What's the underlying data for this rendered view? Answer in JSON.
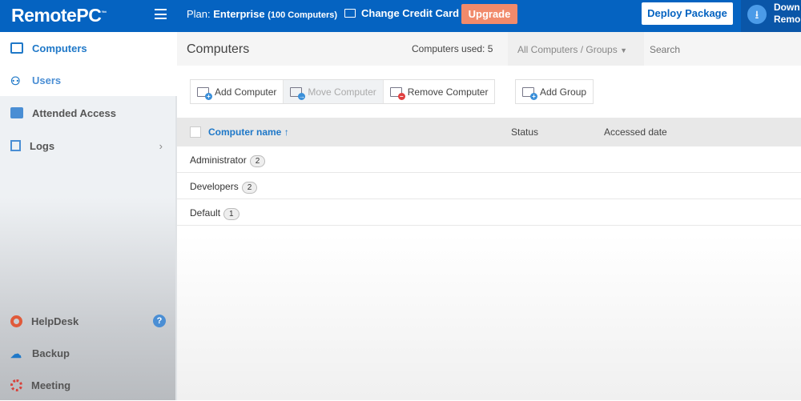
{
  "topbar": {
    "logo": "RemotePC",
    "tm": "™",
    "plan_label": "Plan:",
    "plan_name": "Enterprise",
    "plan_detail": "(100 Computers)",
    "change_card": "Change Credit Card",
    "upgrade": "Upgrade",
    "deploy": "Deploy Package",
    "download_line1": "Down",
    "download_line2": "Remo"
  },
  "sidebar": {
    "items": [
      {
        "label": "Computers"
      },
      {
        "label": "Users"
      },
      {
        "label": "Attended Access"
      },
      {
        "label": "Logs"
      },
      {
        "label": "HelpDesk"
      },
      {
        "label": "Backup"
      },
      {
        "label": "Meeting"
      }
    ],
    "help": "?"
  },
  "main": {
    "title": "Computers",
    "used": "Computers used: 5",
    "filter": "All Computers / Groups",
    "search_placeholder": "Search",
    "buttons": {
      "add": "Add Computer",
      "move": "Move Computer",
      "remove": "Remove Computer",
      "group": "Add Group"
    },
    "columns": {
      "name": "Computer name",
      "sort": "↑",
      "status": "Status",
      "accessed": "Accessed date"
    },
    "rows": [
      {
        "name": "Administrator",
        "count": "2"
      },
      {
        "name": "Developers",
        "count": "2"
      },
      {
        "name": "Default",
        "count": "1"
      }
    ]
  },
  "colors": {
    "brand": "#0563c1",
    "upgrade": "#f18a6b",
    "link": "#1f78c8"
  }
}
